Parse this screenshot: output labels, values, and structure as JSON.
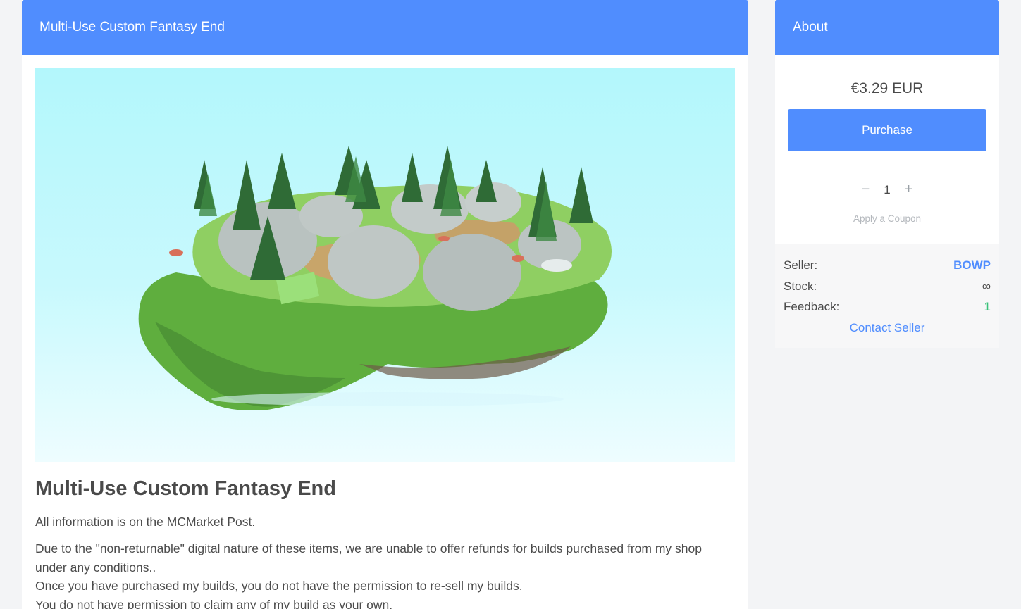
{
  "main": {
    "header_title": "Multi-Use Custom Fantasy End",
    "image_alt": "Floating voxel island with trees and hills",
    "product_title": "Multi-Use Custom Fantasy End",
    "paragraph1": "All information is on the MCMarket Post.",
    "paragraph2_lines": [
      "Due to the \"non-returnable\" digital nature of these items, we are unable to offer refunds for builds purchased from my shop under any conditions..",
      "Once you have purchased my builds, you do not have the permission to re-sell my builds.",
      "You do not have permission to claim any of my build as your own."
    ]
  },
  "sidebar": {
    "header_title": "About",
    "price": "€3.29 EUR",
    "purchase_label": "Purchase",
    "quantity": {
      "minus": "−",
      "value": "1",
      "plus": "+"
    },
    "coupon_label": "Apply a Coupon",
    "info": {
      "seller_label": "Seller:",
      "seller_value": "BOWP",
      "stock_label": "Stock:",
      "stock_value": "∞",
      "feedback_label": "Feedback:",
      "feedback_value": "1",
      "contact_label": "Contact Seller"
    }
  },
  "colors": {
    "accent": "#508dfe",
    "feedback_green": "#3ac27a",
    "background": "#f3f4f6"
  }
}
